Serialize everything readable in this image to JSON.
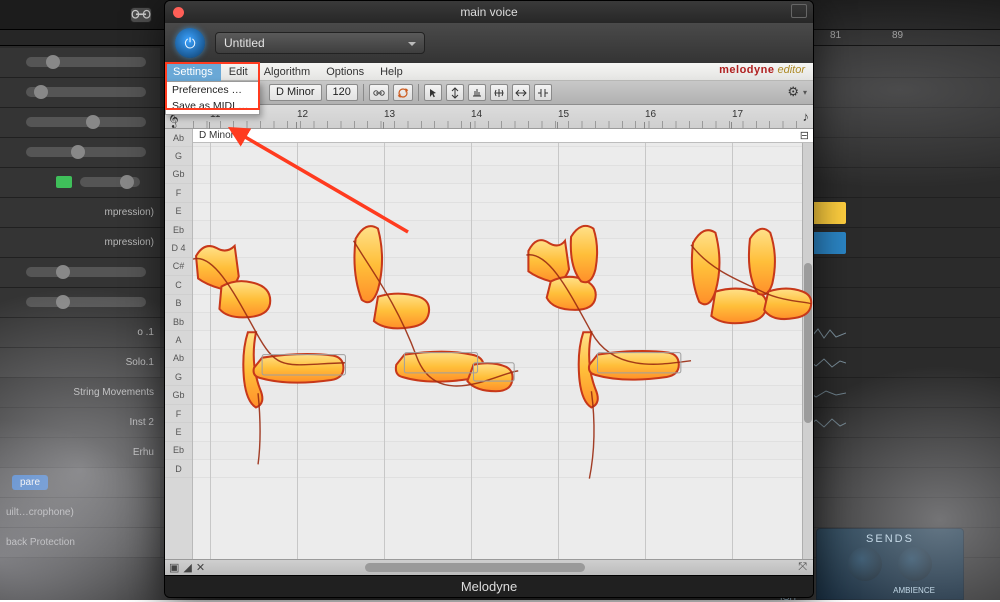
{
  "daw": {
    "ruler_marks": [
      "81",
      "89"
    ],
    "tracks": {
      "t4": "mpression)",
      "t5": "mpression)",
      "t10": "o .1",
      "t11": "Solo.1",
      "t12": "String Movements",
      "t13": "Inst 2",
      "t14": "Erhu"
    },
    "buttons": {
      "compare": "pare",
      "builtin_mic": "uilt…crophone)",
      "feedback": "back Protection"
    },
    "sends": {
      "title": "SENDS",
      "knob_left": "IGH",
      "knob_right": "AMBIENCE"
    }
  },
  "plugin": {
    "window_title": "main voice",
    "preset": "Untitled",
    "footer_name": "Melodyne",
    "brand_main": "melodyne",
    "brand_sub": "editor",
    "menu": {
      "items": [
        "Settings",
        "Edit",
        "Algorithm",
        "Options",
        "Help"
      ],
      "selected_index": 0,
      "dropdown": [
        "Preferences …",
        "Save as MIDI …"
      ]
    },
    "toolbar": {
      "key": "D Minor",
      "tempo": "120",
      "tool_names": [
        "link-icon",
        "sync-icon",
        "cursor-tool",
        "pitch-tool",
        "amplitude-tool",
        "timing-tool",
        "stretch-tool",
        "separate-tool"
      ]
    },
    "ruler_bars": [
      "11",
      "12",
      "13",
      "14",
      "15",
      "16",
      "17"
    ],
    "scale_label": "D Minor",
    "keys": [
      "Ab",
      "G",
      "Gb",
      "F",
      "E",
      "Eb",
      "D 4",
      "C#",
      "C",
      "B",
      "Bb",
      "A",
      "Ab",
      "G",
      "Gb",
      "F",
      "E",
      "Eb",
      "D"
    ]
  }
}
